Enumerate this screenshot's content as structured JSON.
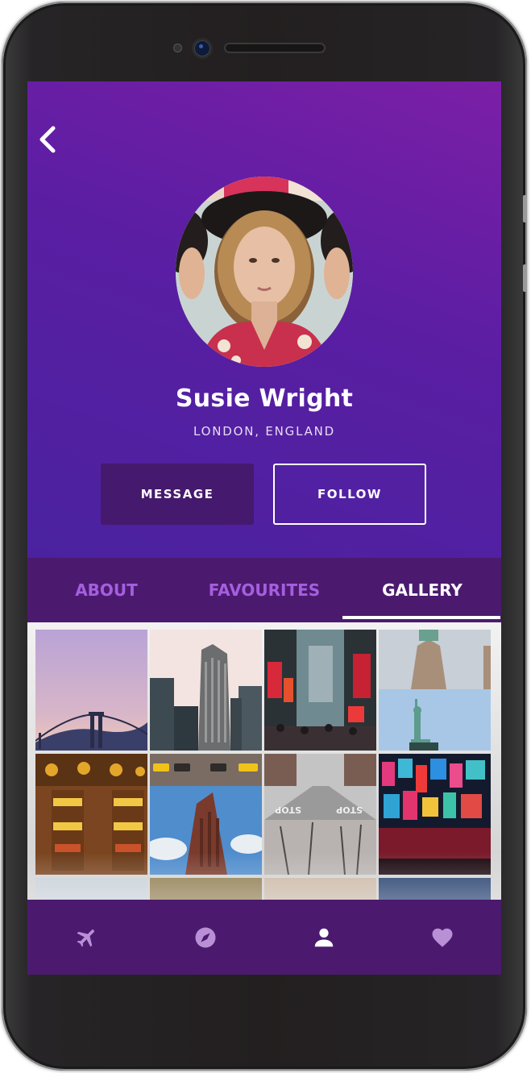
{
  "profile": {
    "name": "Susie Wright",
    "location": "LONDON, ENGLAND"
  },
  "actions": {
    "message_label": "MESSAGE",
    "follow_label": "FOLLOW"
  },
  "tabs": [
    {
      "label": "ABOUT",
      "active": false
    },
    {
      "label": "FAVOURITES",
      "active": false
    },
    {
      "label": "GALLERY",
      "active": true
    }
  ],
  "gallery": {
    "items": [
      {
        "name": "bridge-photo"
      },
      {
        "name": "flatiron-building-photo"
      },
      {
        "name": "times-square-street-photo"
      },
      {
        "name": "statue-of-liberty-photo"
      },
      {
        "name": "food-market-photo"
      },
      {
        "name": "taxi-building-photo"
      },
      {
        "name": "stop-street-photo"
      },
      {
        "name": "neon-billboards-photo"
      }
    ]
  },
  "nav": {
    "items": [
      {
        "icon": "airplane-icon",
        "active": false
      },
      {
        "icon": "compass-icon",
        "active": false
      },
      {
        "icon": "person-icon",
        "active": true
      },
      {
        "icon": "heart-icon",
        "active": false
      }
    ]
  },
  "colors": {
    "header_gradient": [
      "#7b1fa6",
      "#4a22a0"
    ],
    "dark_purple": "#4b1a6e",
    "tab_inactive": "#a65ee0",
    "message_button": "#45196d"
  }
}
